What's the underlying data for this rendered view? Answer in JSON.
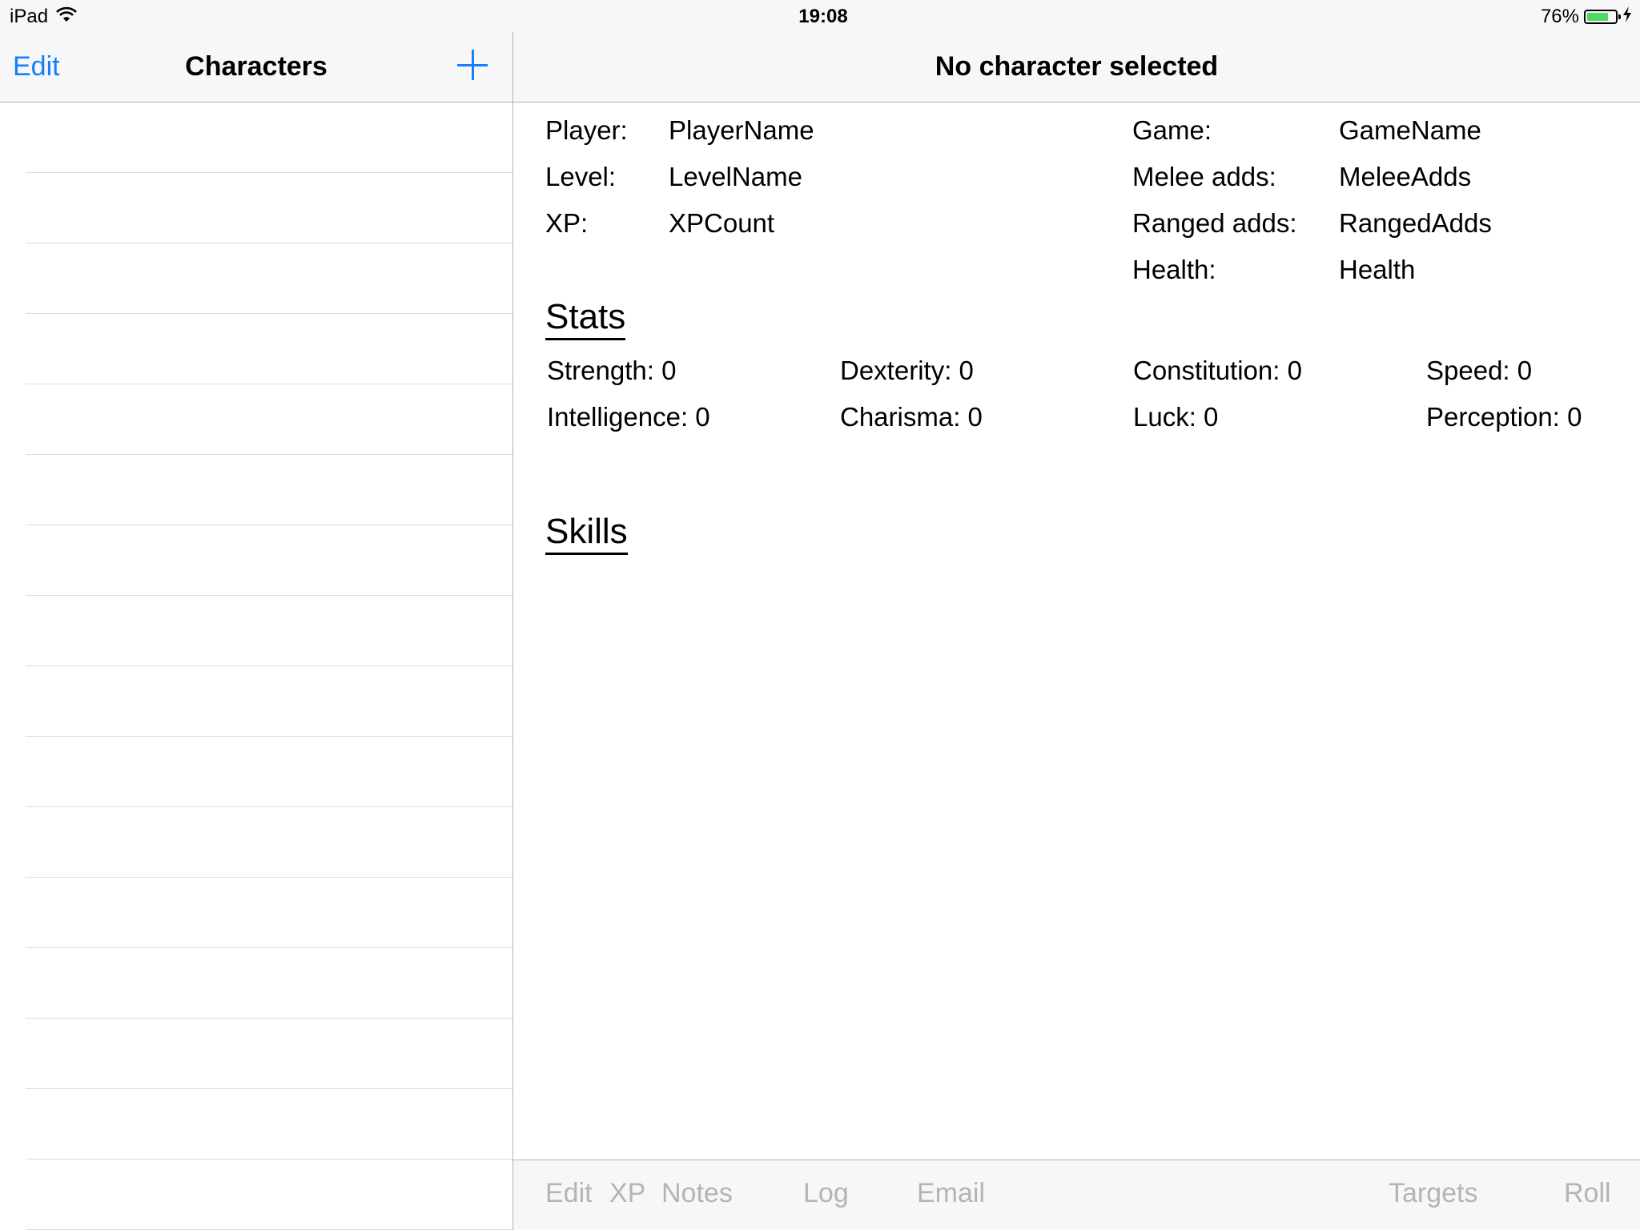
{
  "status_bar": {
    "device": "iPad",
    "time": "19:08",
    "battery_percent": "76%",
    "battery_level": 0.76,
    "charging": true
  },
  "master": {
    "edit_label": "Edit",
    "title": "Characters",
    "add_icon": "plus-icon",
    "rows_visible": 16
  },
  "detail": {
    "title": "No character selected",
    "info": {
      "player_label": "Player:",
      "player_value": "PlayerName",
      "level_label": "Level:",
      "level_value": "LevelName",
      "xp_label": "XP:",
      "xp_value": "XPCount",
      "game_label": "Game:",
      "game_value": "GameName",
      "melee_label": "Melee adds:",
      "melee_value": "MeleeAdds",
      "ranged_label": "Ranged adds:",
      "ranged_value": "RangedAdds",
      "health_label": "Health:",
      "health_value": "Health"
    },
    "stats_heading": "Stats",
    "stats": {
      "strength": "Strength: 0",
      "dexterity": "Dexterity: 0",
      "constitution": "Constitution: 0",
      "speed": "Speed: 0",
      "intelligence": "Intelligence: 0",
      "charisma": "Charisma: 0",
      "luck": "Luck: 0",
      "perception": "Perception: 0"
    },
    "skills_heading": "Skills"
  },
  "toolbar": {
    "edit": "Edit",
    "xp": "XP",
    "notes": "Notes",
    "log": "Log",
    "email": "Email",
    "targets": "Targets",
    "roll": "Roll"
  },
  "colors": {
    "accent": "#157efb",
    "bar_background": "#f7f7f7",
    "disabled_text": "#b4b4b4",
    "battery_green": "#4cd964"
  }
}
